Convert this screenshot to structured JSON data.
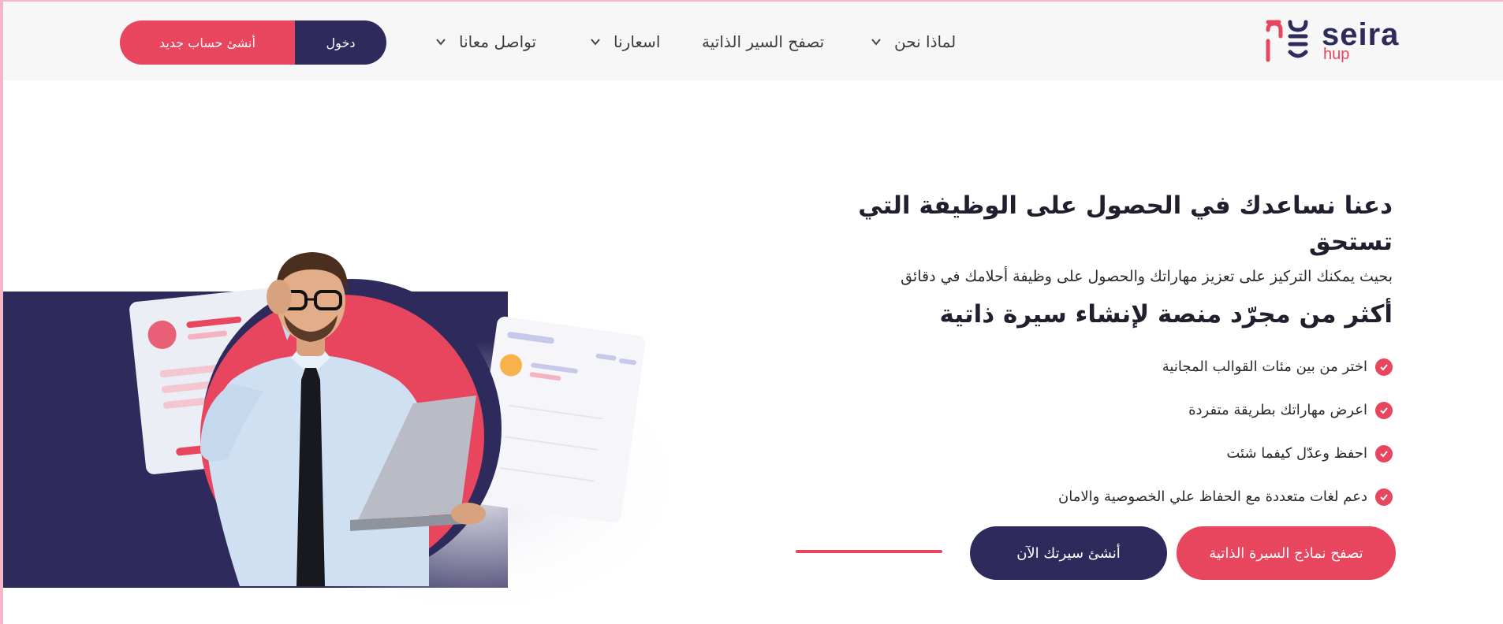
{
  "nav": {
    "logo_word": "seira",
    "logo_sub": "hup",
    "items": [
      {
        "label": "لماذا نحن",
        "has_dropdown": true,
        "icon": "chevron-down-icon"
      },
      {
        "label": "تصفح السير الذاتية",
        "has_dropdown": false
      },
      {
        "label": "اسعارنا",
        "has_dropdown": true,
        "icon": "chevron-down-icon"
      },
      {
        "label": "تواصل معانا",
        "has_dropdown": true,
        "icon": "chevron-down-icon"
      }
    ],
    "login_label": "دخول",
    "create_account_label": "أنشئ حساب جديد"
  },
  "hero": {
    "headline": "دعنا نساعدك في الحصول على الوظيفة التي تستحق",
    "subheadline": "بحيث يمكنك التركيز على تعزيز مهاراتك والحصول على وظيفة أحلامك في دقائق",
    "title2": "أكثر من مجرّد منصة لإنشاء سيرة ذاتية",
    "features": [
      "اختر من بين مئات القوالب المجانية",
      "اعرض مهاراتك بطريقة متفردة",
      "احفظ وعدّل كيفما شئت",
      "دعم لغات متعددة مع الحفاظ علي الخصوصية والامان"
    ],
    "feature_icon": "check-circle-icon",
    "cta_browse": "تصفح نماذج السيرة الذاتية",
    "cta_create": "أنشئ سيرتك الآن"
  },
  "colors": {
    "accent": "#e8455f",
    "navy": "#2e2a5b",
    "nav_bg": "#f7f7f7"
  }
}
